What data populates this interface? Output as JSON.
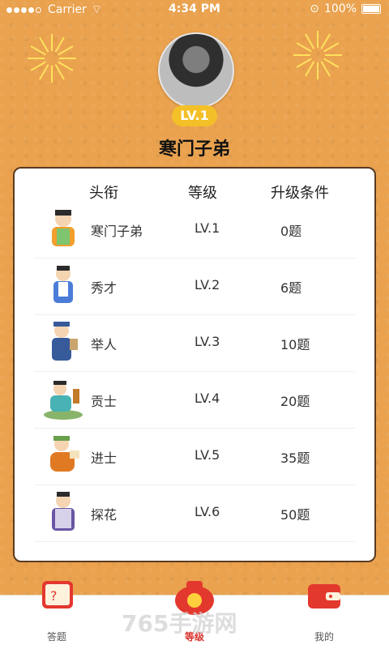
{
  "statusbar": {
    "carrier": "Carrier",
    "time": "4:34 PM",
    "battery": "100%"
  },
  "profile": {
    "level_badge": "LV.1",
    "title": "寒门子弟"
  },
  "table": {
    "headers": [
      "头衔",
      "等级",
      "升级条件"
    ],
    "rows": [
      {
        "title": "寒门子弟",
        "level": "LV.1",
        "condition": "0题",
        "color": "#f29f2b"
      },
      {
        "title": "秀才",
        "level": "LV.2",
        "condition": "6题",
        "color": "#4b7dd8"
      },
      {
        "title": "举人",
        "level": "LV.3",
        "condition": "10题",
        "color": "#375a9a"
      },
      {
        "title": "贡士",
        "level": "LV.4",
        "condition": "20题",
        "color": "#49b2b4"
      },
      {
        "title": "进士",
        "level": "LV.5",
        "condition": "35题",
        "color": "#e07a22"
      },
      {
        "title": "探花",
        "level": "LV.6",
        "condition": "50题",
        "color": "#6a55a4"
      }
    ]
  },
  "bottom_nav": {
    "tabs": [
      {
        "label": "答题",
        "icon": "quiz-card-icon",
        "active": false
      },
      {
        "label": "等级",
        "icon": "money-bag-icon",
        "active": true
      },
      {
        "label": "我的",
        "icon": "wallet-icon",
        "active": false
      }
    ]
  },
  "watermark": "765手游网"
}
